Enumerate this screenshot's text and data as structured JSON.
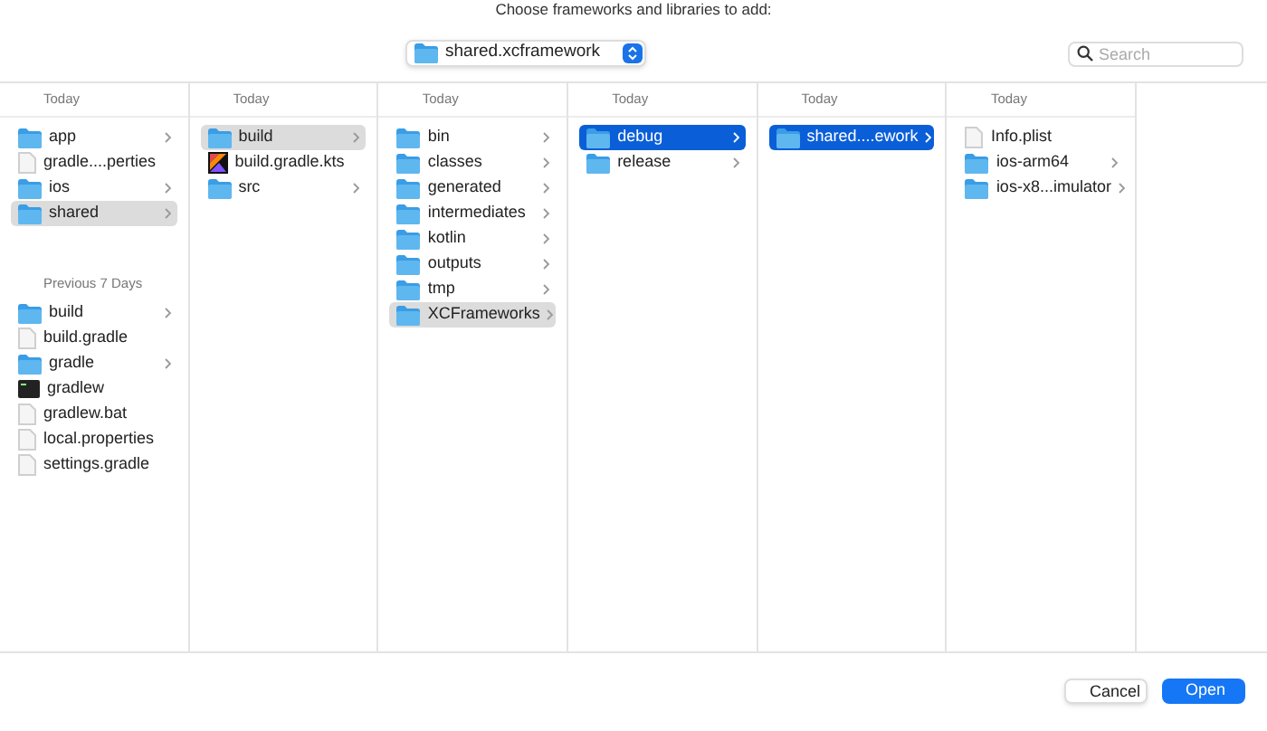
{
  "prompt": "Choose frameworks and libraries to add:",
  "location": {
    "value": "shared.xcframework"
  },
  "search": {
    "placeholder": "Search"
  },
  "columns": [
    {
      "focused": false,
      "sections": [
        {
          "header": "Today",
          "items": [
            {
              "name": "app",
              "kind": "folder",
              "expandable": true,
              "selected": false
            },
            {
              "name": "gradle....perties",
              "kind": "file",
              "expandable": false,
              "selected": false
            },
            {
              "name": "ios",
              "kind": "folder",
              "expandable": true,
              "selected": false
            },
            {
              "name": "shared",
              "kind": "folder",
              "expandable": true,
              "selected": true
            }
          ]
        },
        {
          "header": "Previous 7 Days",
          "items": [
            {
              "name": "build",
              "kind": "folder",
              "expandable": true,
              "selected": false
            },
            {
              "name": "build.gradle",
              "kind": "file",
              "expandable": false,
              "selected": false
            },
            {
              "name": "gradle",
              "kind": "folder",
              "expandable": true,
              "selected": false
            },
            {
              "name": "gradlew",
              "kind": "terminal",
              "expandable": false,
              "selected": false
            },
            {
              "name": "gradlew.bat",
              "kind": "file",
              "expandable": false,
              "selected": false
            },
            {
              "name": "local.properties",
              "kind": "file",
              "expandable": false,
              "selected": false
            },
            {
              "name": "settings.gradle",
              "kind": "file",
              "expandable": false,
              "selected": false
            }
          ]
        }
      ]
    },
    {
      "focused": false,
      "sections": [
        {
          "header": "Today",
          "items": [
            {
              "name": "build",
              "kind": "folder",
              "expandable": true,
              "selected": true
            },
            {
              "name": "build.gradle.kts",
              "kind": "kotlin",
              "expandable": false,
              "selected": false
            },
            {
              "name": "src",
              "kind": "folder",
              "expandable": true,
              "selected": false
            }
          ]
        }
      ]
    },
    {
      "focused": false,
      "sections": [
        {
          "header": "Today",
          "items": [
            {
              "name": "bin",
              "kind": "folder",
              "expandable": true,
              "selected": false
            },
            {
              "name": "classes",
              "kind": "folder",
              "expandable": true,
              "selected": false
            },
            {
              "name": "generated",
              "kind": "folder",
              "expandable": true,
              "selected": false
            },
            {
              "name": "intermediates",
              "kind": "folder",
              "expandable": true,
              "selected": false
            },
            {
              "name": "kotlin",
              "kind": "folder",
              "expandable": true,
              "selected": false
            },
            {
              "name": "outputs",
              "kind": "folder",
              "expandable": true,
              "selected": false
            },
            {
              "name": "tmp",
              "kind": "folder",
              "expandable": true,
              "selected": false
            },
            {
              "name": "XCFrameworks",
              "kind": "folder",
              "expandable": true,
              "selected": true
            }
          ]
        }
      ]
    },
    {
      "focused": true,
      "sections": [
        {
          "header": "Today",
          "items": [
            {
              "name": "debug",
              "kind": "folder",
              "expandable": true,
              "selected": true
            },
            {
              "name": "release",
              "kind": "folder",
              "expandable": true,
              "selected": false
            }
          ]
        }
      ]
    },
    {
      "focused": true,
      "sections": [
        {
          "header": "Today",
          "items": [
            {
              "name": "shared....ework",
              "kind": "folder",
              "expandable": true,
              "selected": true
            }
          ]
        }
      ]
    },
    {
      "sections": [
        {
          "header": "Today",
          "items": [
            {
              "name": "Info.plist",
              "kind": "file",
              "expandable": false,
              "selected": false
            },
            {
              "name": "ios-arm64",
              "kind": "folder",
              "expandable": true,
              "selected": false
            },
            {
              "name": "ios-x8...imulator",
              "kind": "folder",
              "expandable": true,
              "selected": false
            }
          ]
        }
      ]
    }
  ],
  "buttons": [
    {
      "label": "Cancel",
      "primary": false
    },
    {
      "label": "Open",
      "primary": true
    }
  ]
}
